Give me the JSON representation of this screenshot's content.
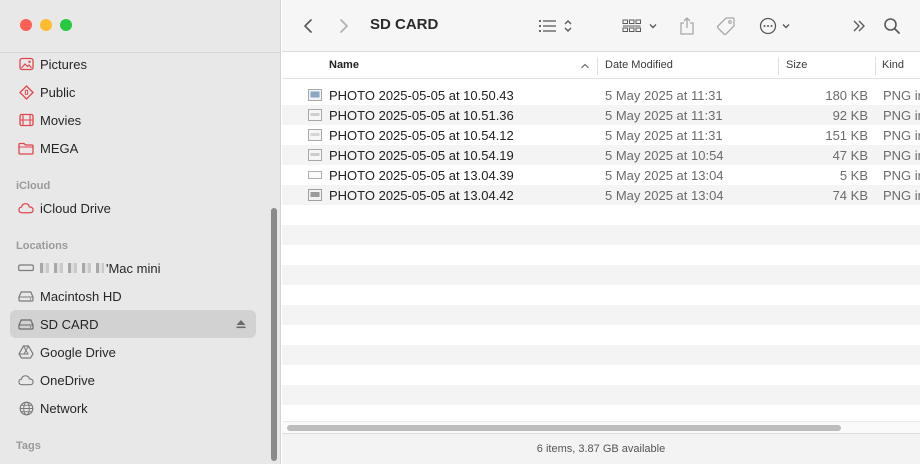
{
  "window": {
    "title": "SD CARD"
  },
  "sidebar": {
    "favorites": [
      {
        "label": "Pictures",
        "icon": "pictures-icon"
      },
      {
        "label": "Public",
        "icon": "public-icon"
      },
      {
        "label": "Movies",
        "icon": "movies-icon"
      },
      {
        "label": "MEGA",
        "icon": "folder-icon"
      }
    ],
    "icloud_header": "iCloud",
    "icloud": [
      {
        "label": "iCloud Drive",
        "icon": "cloud-icon"
      }
    ],
    "locations_header": "Locations",
    "locations": [
      {
        "label": "'Mac mini",
        "icon": "computer-icon"
      },
      {
        "label": "Macintosh HD",
        "icon": "disk-icon"
      },
      {
        "label": "SD CARD",
        "icon": "disk-icon",
        "selected": true
      },
      {
        "label": "Google Drive",
        "icon": "google-drive-icon"
      },
      {
        "label": "OneDrive",
        "icon": "cloud-icon"
      },
      {
        "label": "Network",
        "icon": "globe-icon"
      }
    ],
    "tags_header": "Tags"
  },
  "columns": {
    "name": "Name",
    "date": "Date Modified",
    "size": "Size",
    "kind": "Kind"
  },
  "files": [
    {
      "name": "PHOTO 2025-05-05 at 10.50.43",
      "date": "5 May 2025 at 11:31",
      "size": "180 KB",
      "kind": "PNG ir"
    },
    {
      "name": "PHOTO 2025-05-05 at 10.51.36",
      "date": "5 May 2025 at 11:31",
      "size": "92 KB",
      "kind": "PNG ir"
    },
    {
      "name": "PHOTO 2025-05-05 at 10.54.12",
      "date": "5 May 2025 at 11:31",
      "size": "151 KB",
      "kind": "PNG ir"
    },
    {
      "name": "PHOTO 2025-05-05 at 10.54.19",
      "date": "5 May 2025 at 10:54",
      "size": "47 KB",
      "kind": "PNG ir"
    },
    {
      "name": "PHOTO 2025-05-05 at 13.04.39",
      "date": "5 May 2025 at 13:04",
      "size": "5 KB",
      "kind": "PNG ir"
    },
    {
      "name": "PHOTO 2025-05-05 at 13.04.42",
      "date": "5 May 2025 at 13:04",
      "size": "74 KB",
      "kind": "PNG ir"
    }
  ],
  "status": {
    "text": "6 items, 3.87 GB available"
  },
  "colors": {
    "sidebar_icon": "#e0454b",
    "sidebar_bg": "#e8e8e8",
    "selected_bg": "#d2d2d2"
  }
}
